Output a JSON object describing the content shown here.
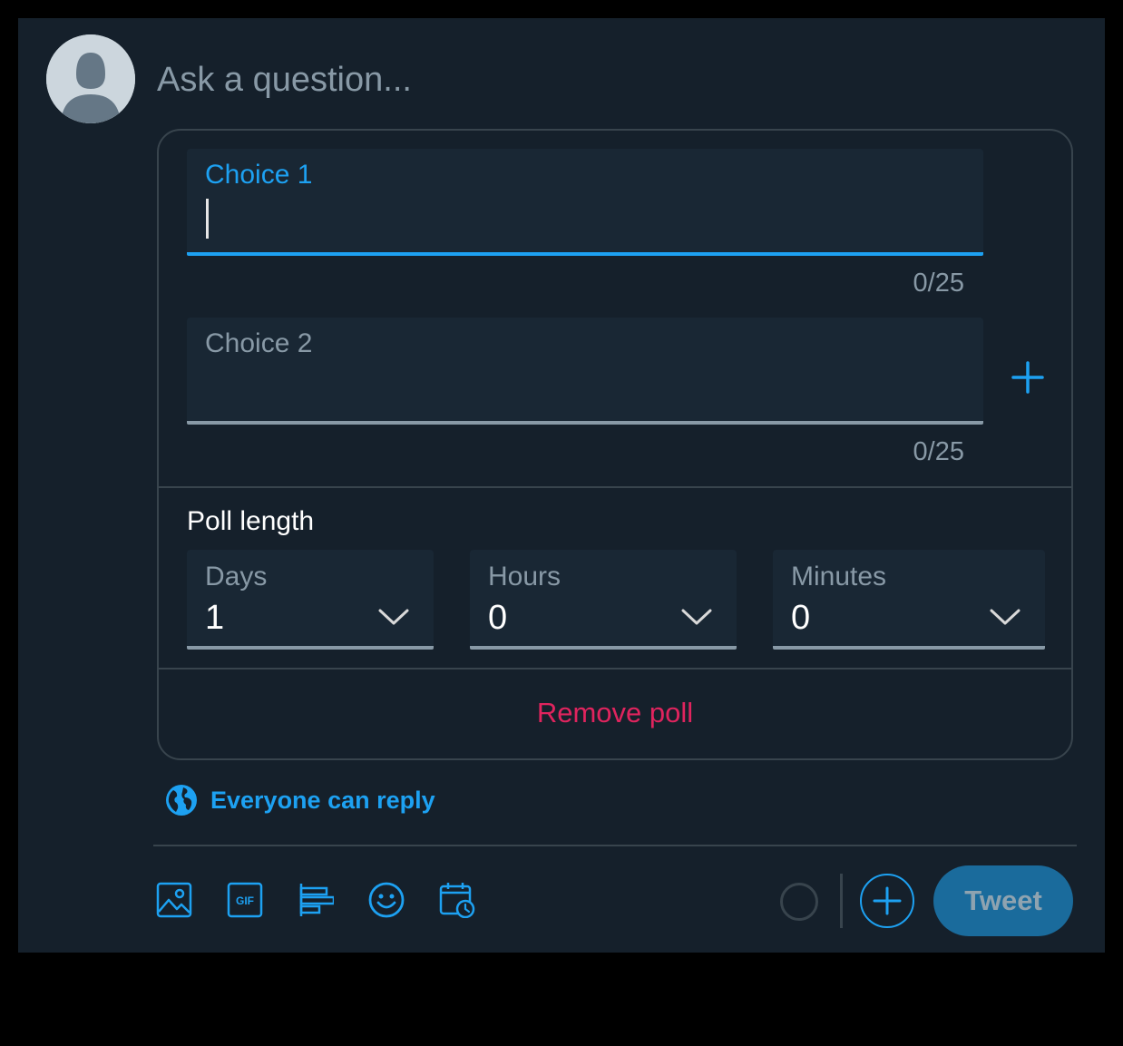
{
  "composer": {
    "placeholder": "Ask a question...",
    "poll": {
      "choices": [
        {
          "label": "Choice 1",
          "value": "",
          "counter": "0/25",
          "active": true
        },
        {
          "label": "Choice 2",
          "value": "",
          "counter": "0/25",
          "active": false
        }
      ],
      "add_choice_icon": "plus-icon",
      "poll_length_label": "Poll length",
      "duration": {
        "days": {
          "label": "Days",
          "value": "1"
        },
        "hours": {
          "label": "Hours",
          "value": "0"
        },
        "minutes": {
          "label": "Minutes",
          "value": "0"
        }
      },
      "remove_label": "Remove poll"
    },
    "reply_setting": {
      "icon": "globe-icon",
      "label": "Everyone can reply"
    },
    "toolbar": {
      "icons": [
        "image-icon",
        "gif-icon",
        "poll-icon",
        "emoji-icon",
        "schedule-icon"
      ],
      "gif_text": "GIF",
      "tweet_label": "Tweet"
    }
  },
  "colors": {
    "background": "#15202b",
    "field_background": "#192734",
    "border": "#38444d",
    "accent": "#1da1f2",
    "danger": "#e0245e",
    "muted_text": "#8899a6",
    "tweet_button_disabled": "#1a6b9c"
  }
}
